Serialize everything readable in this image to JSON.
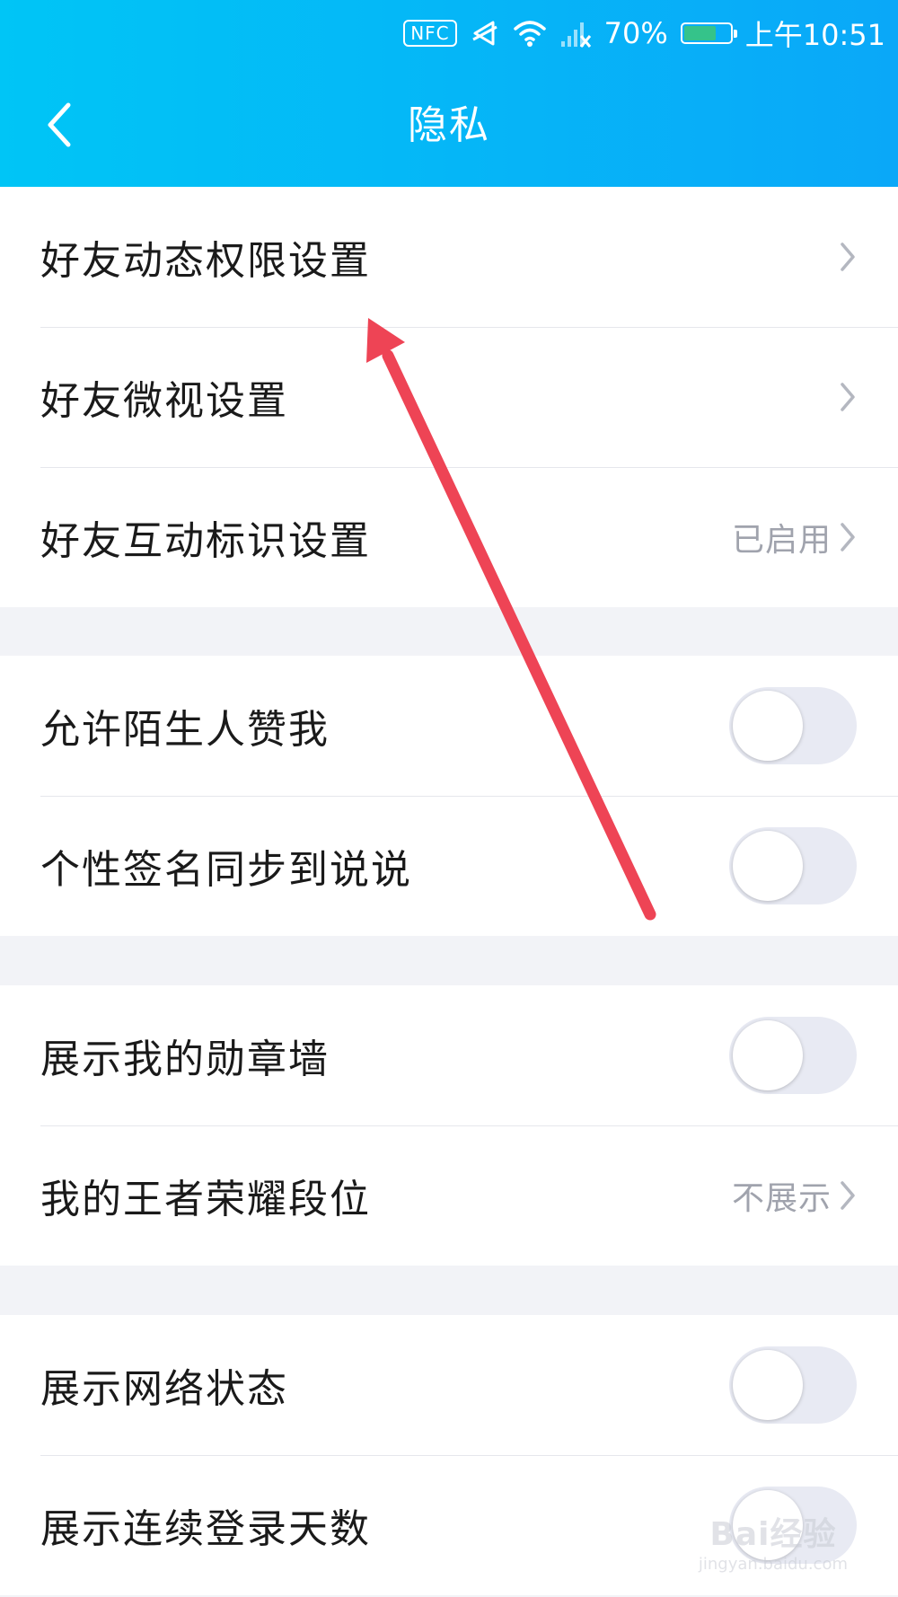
{
  "status_bar": {
    "nfc": "NFC",
    "battery_percent": "70%",
    "battery_level": 0.7,
    "time": "上午10:51",
    "icons": [
      "vibrate-icon",
      "wifi-icon",
      "signal-icon"
    ]
  },
  "header": {
    "title": "隐私",
    "back_icon": "chevron-left-icon"
  },
  "sections": [
    {
      "rows": [
        {
          "label": "好友动态权限设置",
          "type": "link"
        },
        {
          "label": "好友微视设置",
          "type": "link"
        },
        {
          "label": "好友互动标识设置",
          "type": "link",
          "value": "已启用"
        }
      ]
    },
    {
      "rows": [
        {
          "label": "允许陌生人赞我",
          "type": "toggle",
          "on": false
        },
        {
          "label": "个性签名同步到说说",
          "type": "toggle",
          "on": false
        }
      ]
    },
    {
      "rows": [
        {
          "label": "展示我的勋章墙",
          "type": "toggle",
          "on": false
        },
        {
          "label": "我的王者荣耀段位",
          "type": "link",
          "value": "不展示"
        }
      ]
    },
    {
      "rows": [
        {
          "label": "展示网络状态",
          "type": "toggle",
          "on": false
        },
        {
          "label": "展示连续登录天数",
          "type": "toggle",
          "on": false
        }
      ]
    }
  ],
  "overlay": {
    "arrow_color": "#ee4455"
  },
  "watermark": {
    "main": "Bai经验",
    "sub": "jingyan.baidu.com"
  },
  "colors": {
    "header_start": "#00c5f6",
    "header_end": "#0aa8f8",
    "secondary_text": "#a0a3ad",
    "toggle_off": "#e8eaf3"
  }
}
